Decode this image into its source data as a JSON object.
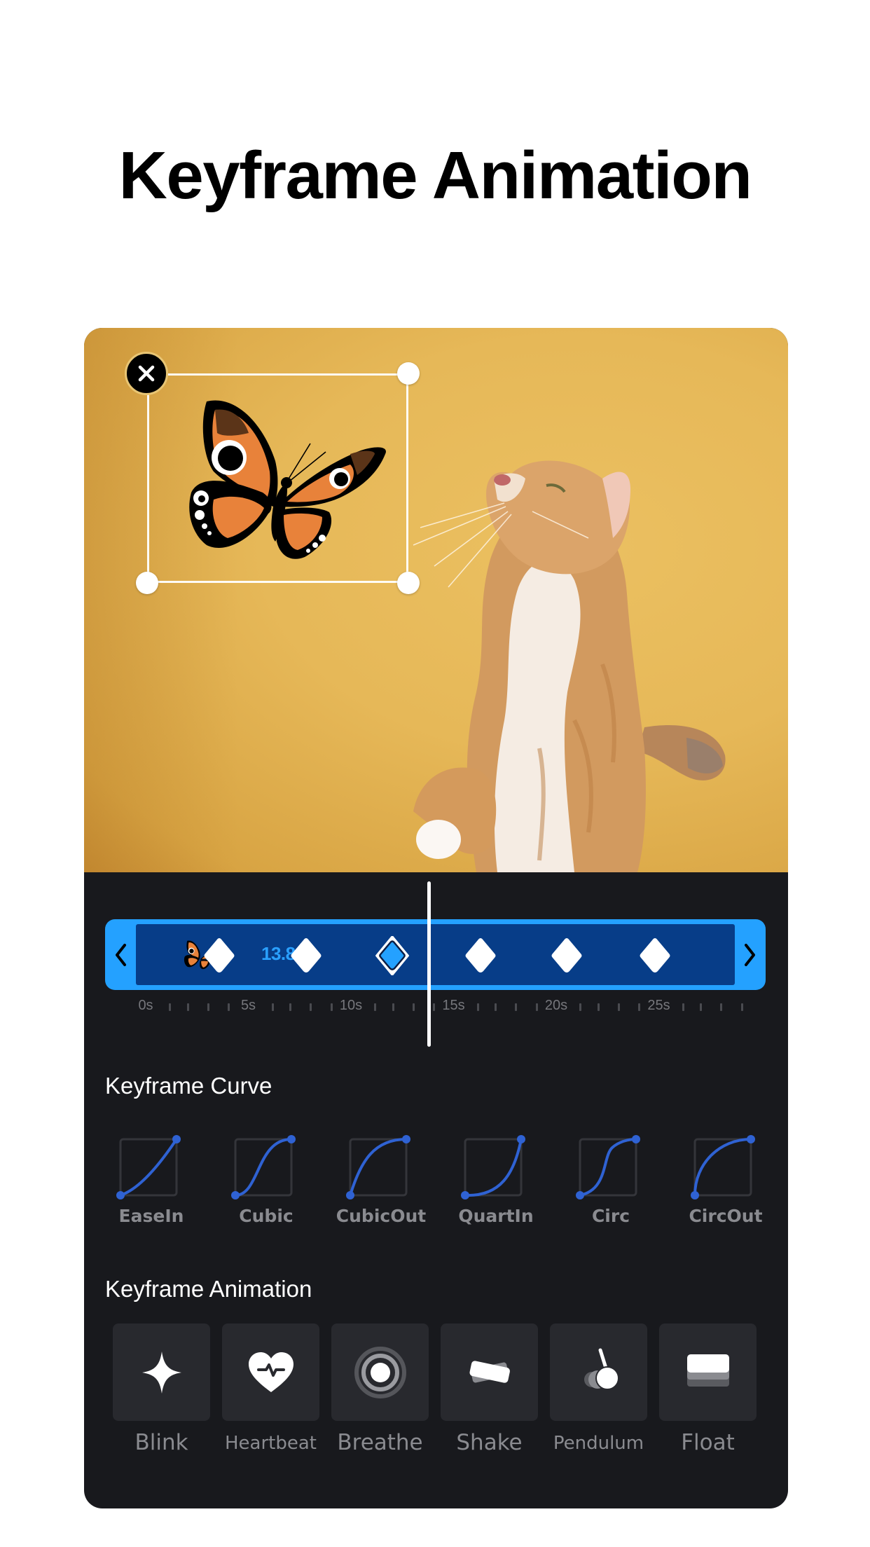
{
  "header": {
    "title": "Keyframe Animation"
  },
  "preview": {
    "subject": "cat-photo",
    "sticker": "butterfly-sticker",
    "close_icon": "close-icon"
  },
  "timeline": {
    "current_time": "13.8s",
    "playhead_seconds": 13.8,
    "keyframes_seconds": [
      3.6,
      7.8,
      12.0,
      16.3,
      20.5,
      24.8
    ],
    "selected_keyframe_index": 2,
    "ruler_labels": [
      "0s",
      "5s",
      "10s",
      "15s",
      "20s",
      "25s"
    ],
    "left_arrow_icon": "chevron-left-icon",
    "right_arrow_icon": "chevron-right-icon",
    "colors": {
      "track": "#24a1ff",
      "track_inner": "#073d88",
      "selected_keyframe": "#24a1ff"
    }
  },
  "curves": {
    "title": "Keyframe Curve",
    "items": [
      {
        "label": "EaseIn",
        "type": "ease-in"
      },
      {
        "label": "Cubic",
        "type": "cubic"
      },
      {
        "label": "CubicOut",
        "type": "cubic-out"
      },
      {
        "label": "QuartIn",
        "type": "quart-in"
      },
      {
        "label": "Circ",
        "type": "circ"
      },
      {
        "label": "CircOut",
        "type": "circ-out"
      }
    ],
    "curve_color": "#2f62d3"
  },
  "animations": {
    "title": "Keyframe Animation",
    "items": [
      {
        "label": "Blink",
        "icon": "sparkle-icon"
      },
      {
        "label": "Heartbeat",
        "icon": "heartbeat-icon"
      },
      {
        "label": "Breathe",
        "icon": "breathe-icon"
      },
      {
        "label": "Shake",
        "icon": "shake-icon"
      },
      {
        "label": "Pendulum",
        "icon": "pendulum-icon"
      },
      {
        "label": "Float",
        "icon": "float-icon"
      }
    ]
  }
}
